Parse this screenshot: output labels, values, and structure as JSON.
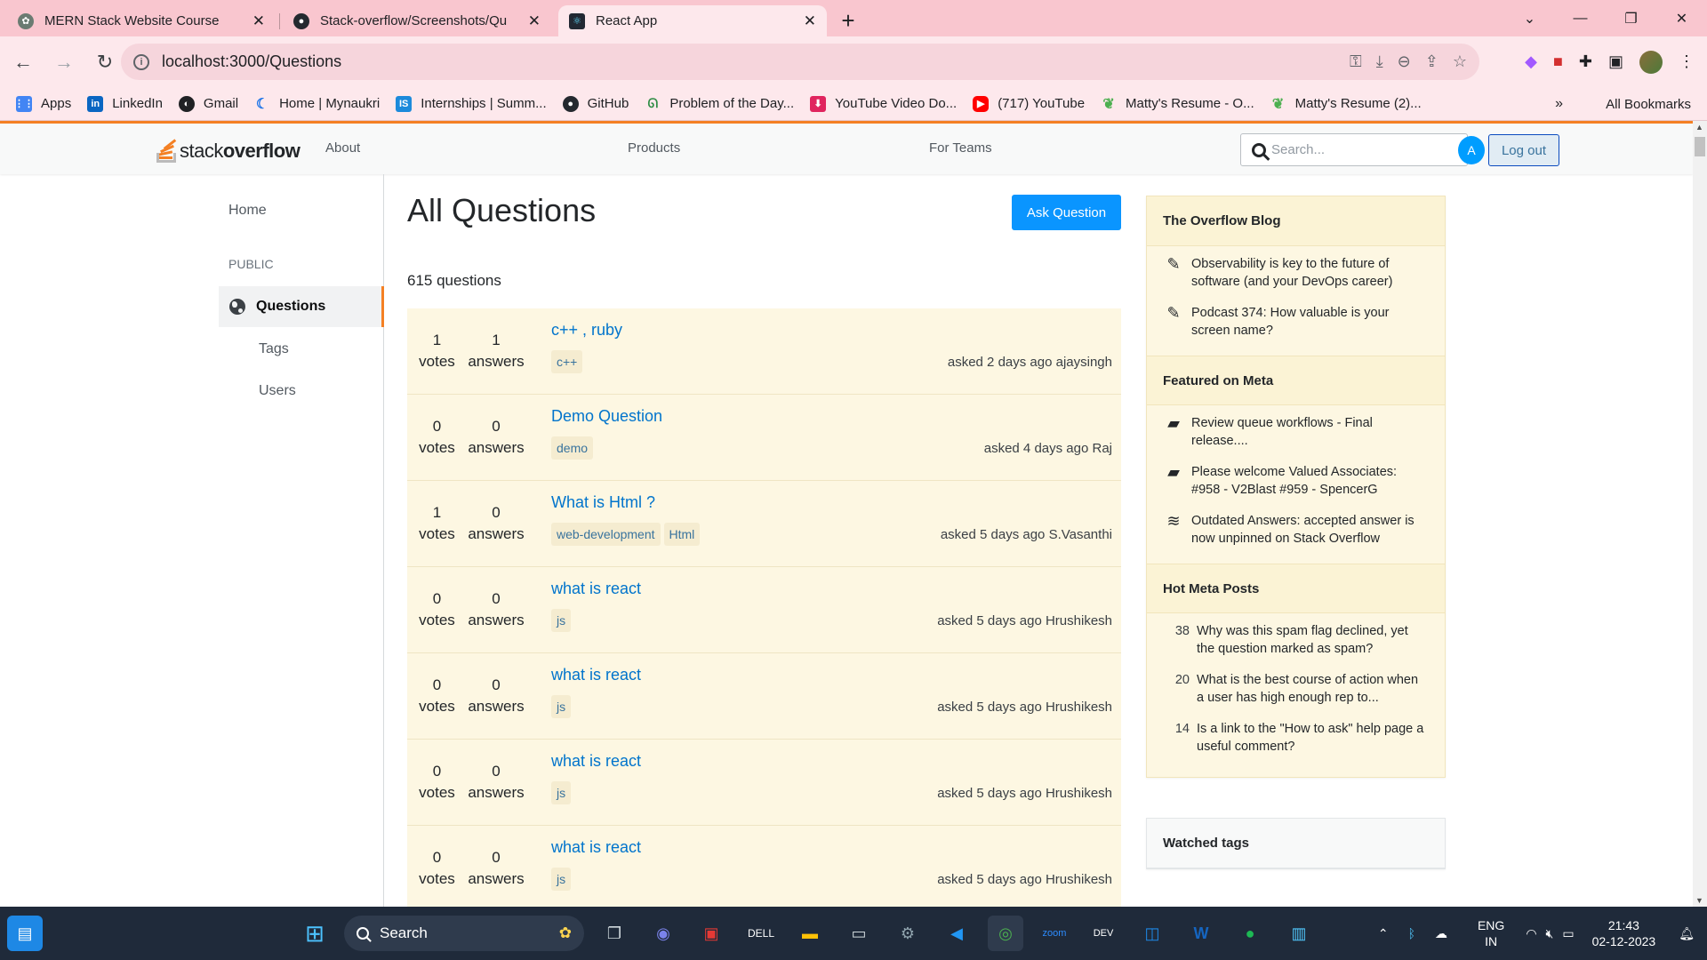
{
  "browser": {
    "tabs": [
      {
        "title": "MERN Stack Website Course",
        "favicon_color": "#6b7b72"
      },
      {
        "title": "Stack-overflow/Screenshots/Qu",
        "favicon_color": "#24292f"
      },
      {
        "title": "React App",
        "favicon_color": "#222833"
      }
    ],
    "new_tab": "+",
    "url": "localhost:3000/Questions",
    "bookmarks": [
      {
        "label": "Apps",
        "color": "#4285f4"
      },
      {
        "label": "LinkedIn",
        "color": "#0a66c2"
      },
      {
        "label": "Gmail",
        "color": "#202124"
      },
      {
        "label": "Home | Mynaukri",
        "color": "#1a73e8"
      },
      {
        "label": "Internships | Summ...",
        "color": "#1c8adb"
      },
      {
        "label": "GitHub",
        "color": "#24292f"
      },
      {
        "label": "Problem of the Day...",
        "color": "#2f8d46"
      },
      {
        "label": "YouTube Video Do...",
        "color": "#e0245e"
      },
      {
        "label": "(717) YouTube",
        "color": "#ff0000"
      },
      {
        "label": "Matty's Resume - O...",
        "color": "#4caf50"
      },
      {
        "label": "Matty's Resume (2)...",
        "color": "#4caf50"
      }
    ],
    "bookmarks_more": "»",
    "all_bookmarks": "All Bookmarks"
  },
  "site": {
    "logo_light": "stack",
    "logo_bold": "overflow",
    "nav": {
      "about": "About",
      "products": "Products",
      "for_teams": "For Teams"
    },
    "search_placeholder": "Search...",
    "avatar_letter": "A",
    "logout": "Log out"
  },
  "leftnav": {
    "home": "Home",
    "public": "PUBLIC",
    "questions": "Questions",
    "tags": "Tags",
    "users": "Users"
  },
  "main": {
    "title": "All Questions",
    "ask_button": "Ask Question",
    "count": "615 questions",
    "questions": [
      {
        "votes": "1",
        "votes_label": "votes",
        "answers": "1",
        "answers_label": "answers",
        "title": "c++ , ruby",
        "tags": [
          "c++"
        ],
        "meta": "asked 2 days ago ajaysingh"
      },
      {
        "votes": "0",
        "votes_label": "votes",
        "answers": "0",
        "answers_label": "answers",
        "title": "Demo Question",
        "tags": [
          "demo"
        ],
        "meta": "asked 4 days ago Raj"
      },
      {
        "votes": "1",
        "votes_label": "votes",
        "answers": "0",
        "answers_label": "answers",
        "title": "What is Html ?",
        "tags": [
          "web-development",
          "Html"
        ],
        "meta": "asked 5 days ago S.Vasanthi"
      },
      {
        "votes": "0",
        "votes_label": "votes",
        "answers": "0",
        "answers_label": "answers",
        "title": "what is react",
        "tags": [
          "js"
        ],
        "meta": "asked 5 days ago Hrushikesh"
      },
      {
        "votes": "0",
        "votes_label": "votes",
        "answers": "0",
        "answers_label": "answers",
        "title": "what is react",
        "tags": [
          "js"
        ],
        "meta": "asked 5 days ago Hrushikesh"
      },
      {
        "votes": "0",
        "votes_label": "votes",
        "answers": "0",
        "answers_label": "answers",
        "title": "what is react",
        "tags": [
          "js"
        ],
        "meta": "asked 5 days ago Hrushikesh"
      },
      {
        "votes": "0",
        "votes_label": "votes",
        "answers": "0",
        "answers_label": "answers",
        "title": "what is react",
        "tags": [
          "js"
        ],
        "meta": "asked 5 days ago Hrushikesh"
      }
    ]
  },
  "sidebar": {
    "blog": {
      "title": "The Overflow Blog",
      "items": [
        {
          "icon": "pencil-icon",
          "text": "Observability is key to the future of software (and your DevOps career)"
        },
        {
          "icon": "pencil-icon",
          "text": "Podcast 374: How valuable is your screen name?"
        }
      ]
    },
    "meta": {
      "title": "Featured on Meta",
      "items": [
        {
          "icon": "chat-bubble-icon",
          "text": "Review queue workflows - Final release...."
        },
        {
          "icon": "chat-bubble-icon",
          "text": "Please welcome Valued Associates: #958 - V2Blast #959 - SpencerG"
        },
        {
          "icon": "stack-logo-icon",
          "text": "Outdated Answers: accepted answer is now unpinned on Stack Overflow"
        }
      ]
    },
    "hot": {
      "title": "Hot Meta Posts",
      "items": [
        {
          "num": "38",
          "text": "Why was this spam flag declined, yet the question marked as spam?"
        },
        {
          "num": "20",
          "text": "What is the best course of action when a user has high enough rep to..."
        },
        {
          "num": "14",
          "text": "Is a link to the \"How to ask\" help page a useful comment?"
        }
      ]
    },
    "watched": {
      "title": "Watched tags"
    }
  },
  "taskbar": {
    "search": "Search",
    "lang_line1": "ENG",
    "lang_line2": "IN",
    "time": "21:43",
    "date": "02-12-2023"
  }
}
